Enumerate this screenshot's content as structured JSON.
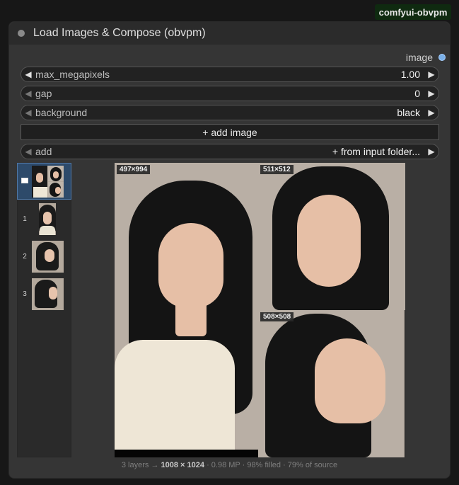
{
  "badge": "comfyui-obvpm",
  "node": {
    "title": "Load Images & Compose (obvpm)",
    "output_label": "image"
  },
  "widgets": {
    "max_megapixels": {
      "label": "max_megapixels",
      "value": "1.00"
    },
    "gap": {
      "label": "gap",
      "value": "0"
    },
    "background": {
      "label": "background",
      "value": "black"
    },
    "add_image_button": "+ add image",
    "add": {
      "label": "add",
      "value": "+ from input folder..."
    }
  },
  "thumbnails": {
    "items": [
      {
        "index": ""
      },
      {
        "index": "1"
      },
      {
        "index": "2"
      },
      {
        "index": "3"
      }
    ]
  },
  "preview": {
    "tiles": [
      {
        "size": "497×994"
      },
      {
        "size": "511×512"
      },
      {
        "size": "508×508"
      }
    ]
  },
  "footer": {
    "layers": "3 layers →",
    "dims": "1008 × 1024",
    "rest": "· 0.98 MP · 98% filled · 79% of source"
  },
  "colors": {
    "node_bg": "#353535",
    "header_bg": "#2b2b2b",
    "badge_bg": "#0f2a10",
    "output_dot": "#7ab0e8",
    "selected_thumb": "#2d4a6a"
  }
}
